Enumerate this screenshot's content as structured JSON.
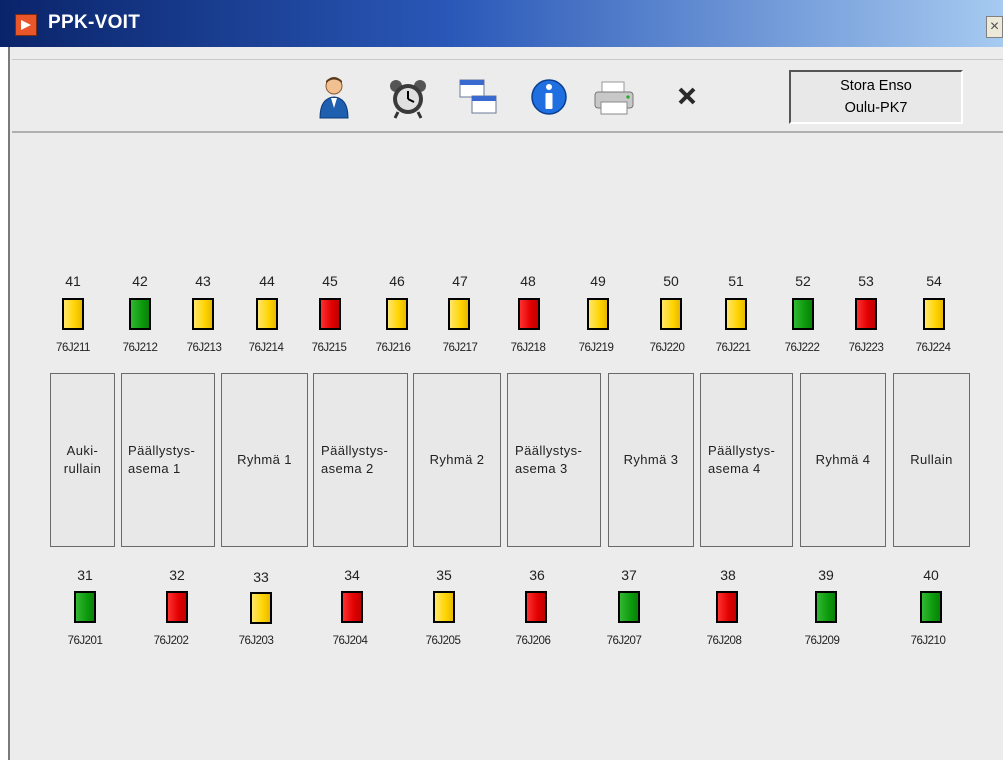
{
  "window": {
    "title": "PPK-VOIT",
    "close_glyph": "×"
  },
  "toolbar": {
    "buttons": [
      {
        "name": "user-button",
        "icon": "user-icon"
      },
      {
        "name": "alarm-button",
        "icon": "alarm-clock-icon"
      },
      {
        "name": "windows-button",
        "icon": "cascade-windows-icon"
      },
      {
        "name": "info-button",
        "icon": "info-icon"
      },
      {
        "name": "print-button",
        "icon": "printer-icon"
      },
      {
        "name": "close-button",
        "icon": "close-icon"
      }
    ],
    "company_line1": "Stora Enso",
    "company_line2": "Oulu-PK7"
  },
  "top_drives": [
    {
      "num": "41",
      "tag": "76J211",
      "status": "yellow"
    },
    {
      "num": "42",
      "tag": "76J212",
      "status": "green"
    },
    {
      "num": "43",
      "tag": "76J213",
      "status": "yellow"
    },
    {
      "num": "44",
      "tag": "76J214",
      "status": "yellow"
    },
    {
      "num": "45",
      "tag": "76J215",
      "status": "red"
    },
    {
      "num": "46",
      "tag": "76J216",
      "status": "yellow"
    },
    {
      "num": "47",
      "tag": "76J217",
      "status": "yellow"
    },
    {
      "num": "48",
      "tag": "76J218",
      "status": "red"
    },
    {
      "num": "49",
      "tag": "76J219",
      "status": "yellow"
    },
    {
      "num": "50",
      "tag": "76J220",
      "status": "yellow"
    },
    {
      "num": "51",
      "tag": "76J221",
      "status": "yellow"
    },
    {
      "num": "52",
      "tag": "76J222",
      "status": "green"
    },
    {
      "num": "53",
      "tag": "76J223",
      "status": "red"
    },
    {
      "num": "54",
      "tag": "76J224",
      "status": "yellow"
    }
  ],
  "sections": [
    "Auki-\nrullain",
    "Päällystys-\nasema 1",
    "Ryhmä 1",
    "Päällystys-\nasema 2",
    "Ryhmä 2",
    "Päällystys-\nasema 3",
    "Ryhmä 3",
    "Päällystys-\nasema 4",
    "Ryhmä 4",
    "Rullain"
  ],
  "bottom_drives": [
    {
      "num": "31",
      "tag": "76J201",
      "status": "green"
    },
    {
      "num": "32",
      "tag": "76J202",
      "status": "red"
    },
    {
      "num": "33",
      "tag": "76J203",
      "status": "yellow"
    },
    {
      "num": "34",
      "tag": "76J204",
      "status": "red"
    },
    {
      "num": "35",
      "tag": "76J205",
      "status": "yellow"
    },
    {
      "num": "36",
      "tag": "76J206",
      "status": "red"
    },
    {
      "num": "37",
      "tag": "76J207",
      "status": "green"
    },
    {
      "num": "38",
      "tag": "76J208",
      "status": "red"
    },
    {
      "num": "39",
      "tag": "76J209",
      "status": "green"
    },
    {
      "num": "40",
      "tag": "76J210",
      "status": "green"
    }
  ],
  "colors": {
    "yellow": "#ffd400",
    "green": "#0e9a0e",
    "red": "#e00000",
    "titlebar": "#0a246a"
  }
}
